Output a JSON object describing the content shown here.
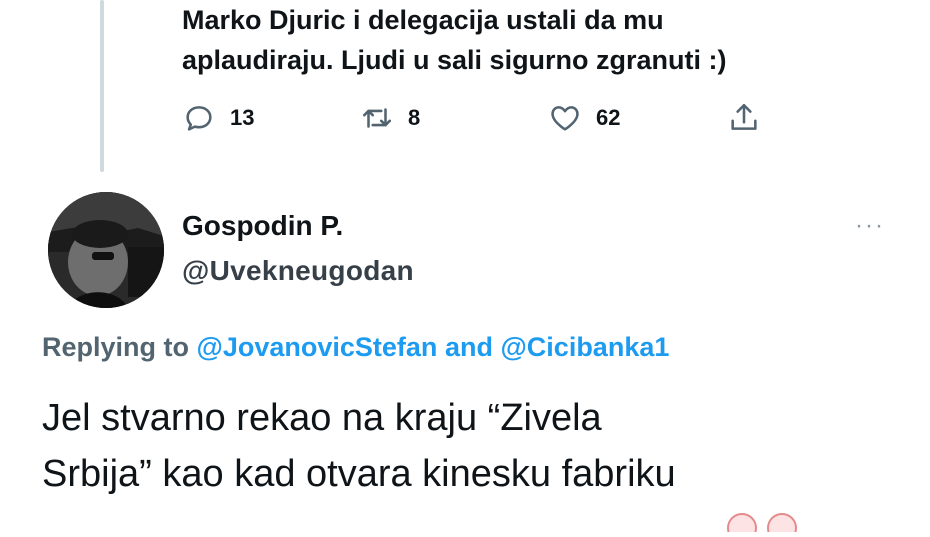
{
  "previous_tweet": {
    "line1": "Marko Djuric i delegacija ustali da mu",
    "line2": "aplaudiraju. Ljudi u sali sigurno zgranuti :)",
    "replies": "13",
    "retweets": "8",
    "likes": "62"
  },
  "tweet": {
    "display_name": "Gospodin P.",
    "handle": "@Uvekneugodan",
    "replying_prefix": "Replying to",
    "reply_user_1": "@JovanovicStefan",
    "reply_and": "and",
    "reply_user_2": "@Cicibanka1",
    "text_line1": "Jel stvarno rekao na kraju “Zivela",
    "text_line2": "Srbija” kao kad otvara kinesku fabriku",
    "more_label": "···"
  },
  "icons": [
    "reply-icon",
    "retweet-icon",
    "like-icon",
    "share-icon",
    "more-icon"
  ],
  "colors": {
    "link": "#1d9bf0",
    "muted": "#536471",
    "text": "#0f1419",
    "thread": "#cfd9de"
  }
}
